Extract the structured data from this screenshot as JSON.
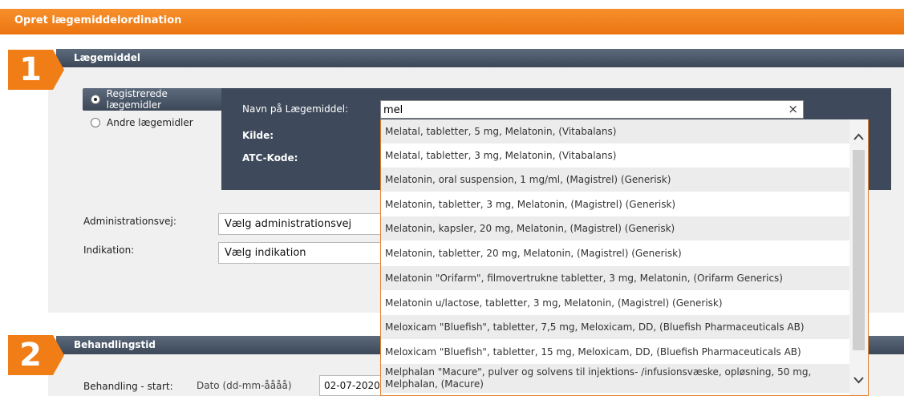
{
  "header": {
    "title": "Opret lægemiddelordination"
  },
  "steps": {
    "one": "1",
    "two": "2"
  },
  "section1": {
    "title": "Lægemiddel",
    "radio_registered": "Registrerede lægemidler",
    "radio_other": "Andre lægemidler",
    "name_label": "Navn på Lægemiddel:",
    "search_value": "mel",
    "clear_icon": "×",
    "source_label": "Kilde:",
    "atc_label": "ATC-Kode:",
    "admin_label": "Administrationsvej:",
    "admin_value": "Vælg administrationsvej",
    "indication_label": "Indikation:",
    "indication_value": "Vælg indikation"
  },
  "section2": {
    "title": "Behandlingstid",
    "start_label": "Behandling - start:",
    "date_label": "Dato (dd-mm-åååå)",
    "date_value": "02-07-2020"
  },
  "dropdown": {
    "items": [
      "Melatal, tabletter, 5 mg, Melatonin, (Vitabalans)",
      "Melatal, tabletter, 3 mg, Melatonin, (Vitabalans)",
      "Melatonin, oral suspension, 1 mg/ml, (Magistrel) (Generisk)",
      "Melatonin, tabletter, 3 mg, Melatonin, (Magistrel) (Generisk)",
      "Melatonin, kapsler, 20 mg, Melatonin, (Magistrel) (Generisk)",
      "Melatonin, tabletter, 20 mg, Melatonin, (Magistrel) (Generisk)",
      "Melatonin \"Orifarm\", filmovertrukne tabletter, 3 mg, Melatonin, (Orifarm Generics)",
      "Melatonin u/lactose, tabletter, 3 mg, Melatonin, (Magistrel) (Generisk)",
      "Meloxicam \"Bluefish\", tabletter, 7,5 mg, Meloxicam, DD, (Bluefish Pharmaceuticals AB)",
      "Meloxicam \"Bluefish\", tabletter, 15 mg, Meloxicam, DD, (Bluefish Pharmaceuticals AB)",
      "Melphalan \"Macure\", pulver og solvens til injektions- /infusionsvæske, opløsning, 50 mg, Melphalan, (Macure)"
    ],
    "scroll_up_icon": "^",
    "scroll_down_icon": "⌄"
  },
  "colors": {
    "accent": "#f07d16",
    "dark": "#3e4a5b",
    "panel": "#f0f0f0"
  }
}
